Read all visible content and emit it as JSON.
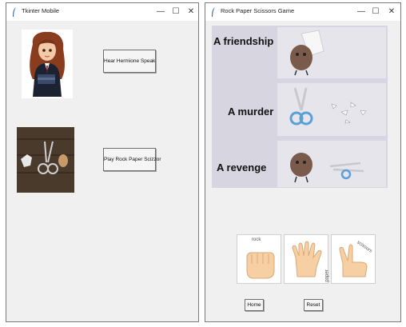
{
  "main_window": {
    "title": "Tkinter Mobile",
    "minimize_glyph": "—",
    "maximize_glyph": "☐",
    "close_glyph": "✕",
    "hermione_button_label": "Hear Hermione Speak",
    "rps_button_label": "Play Rock Paper Scizzor",
    "feather_icon": "feather-icon",
    "images": [
      "hermione-portrait",
      "rock-paper-scissors-photo"
    ]
  },
  "game_window": {
    "title": "Rock Paper Scissors Game",
    "minimize_glyph": "—",
    "maximize_glyph": "☐",
    "close_glyph": "✕",
    "mural_rows": [
      {
        "label": "A friendship"
      },
      {
        "label": "A murder"
      },
      {
        "label": "A revenge"
      }
    ],
    "hand_choices": [
      {
        "name": "rock",
        "label": "rock"
      },
      {
        "name": "paper",
        "label": "paper"
      },
      {
        "name": "scissors",
        "label": "scissors"
      }
    ],
    "home_button_label": "Home",
    "reset_button_label": "Reset"
  },
  "colors": {
    "window_bg": "#f0f0f0",
    "titlebar_bg": "#ffffff",
    "mural_bg": "#d7d6e0",
    "skin": "#f6cfa3",
    "scissor_blue": "#5aa0d8"
  }
}
